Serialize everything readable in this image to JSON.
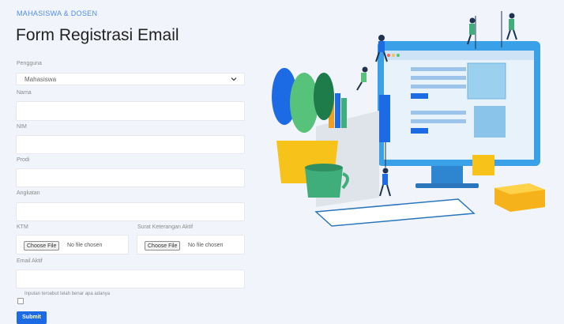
{
  "header": {
    "brand": "MAHASISWA & DOSEN",
    "title": "Form Registrasi Email"
  },
  "form": {
    "pengguna_label": "Pengguna",
    "pengguna_value": "Mahasiswa",
    "nama_label": "Nama",
    "nim_label": "NIM",
    "prodi_label": "Prodi",
    "angkatan_label": "Angkatan",
    "ktm_label": "KTM",
    "surat_label": "Surat Keterangan Aktif",
    "choose_file": "Choose File",
    "no_file": "No file chosen",
    "email_label": "Email Aktif",
    "declaration": "Inputan tersebut telah benar apa adanya",
    "submit": "Submit"
  },
  "colors": {
    "accent": "#1d6ae5",
    "brand": "#4e8df5"
  }
}
